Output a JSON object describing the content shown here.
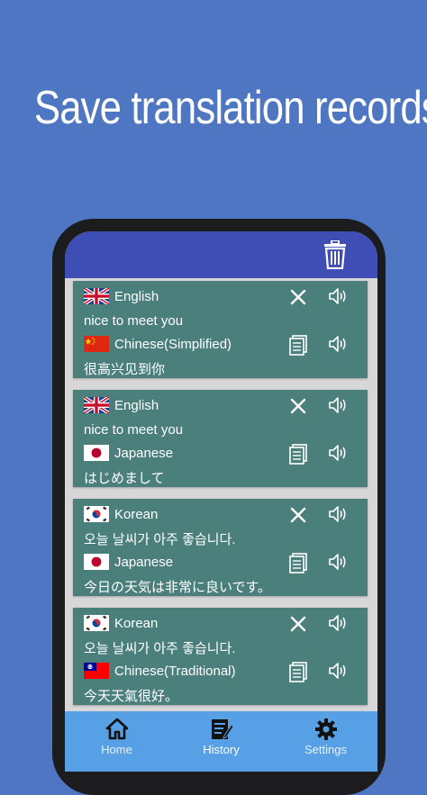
{
  "headline": "Save translation records",
  "nav": {
    "home": "Home",
    "history": "History",
    "settings": "Settings"
  },
  "records": [
    {
      "source_lang": "English",
      "source_flag": "uk-flag",
      "source_text": "nice to meet you",
      "target_lang": "Chinese(Simplified)",
      "target_flag": "china-flag",
      "target_text": "很高兴见到你"
    },
    {
      "source_lang": "English",
      "source_flag": "uk-flag",
      "source_text": "nice to meet you",
      "target_lang": "Japanese",
      "target_flag": "japan-flag",
      "target_text": "はじめまして"
    },
    {
      "source_lang": "Korean",
      "source_flag": "korea-flag",
      "source_text": "오늘 날씨가 아주 좋습니다.",
      "target_lang": "Japanese",
      "target_flag": "japan-flag",
      "target_text": "今日の天気は非常に良いです。"
    },
    {
      "source_lang": "Korean",
      "source_flag": "korea-flag",
      "source_text": "오늘 날씨가 아주 좋습니다.",
      "target_lang": "Chinese(Traditional)",
      "target_flag": "taiwan-flag",
      "target_text": "今天天氣很好。"
    }
  ],
  "colors": {
    "background": "#4f76c2",
    "appbar": "#3f4eb5",
    "card": "#4b7f7c",
    "bottom_nav": "#57a0e6"
  }
}
